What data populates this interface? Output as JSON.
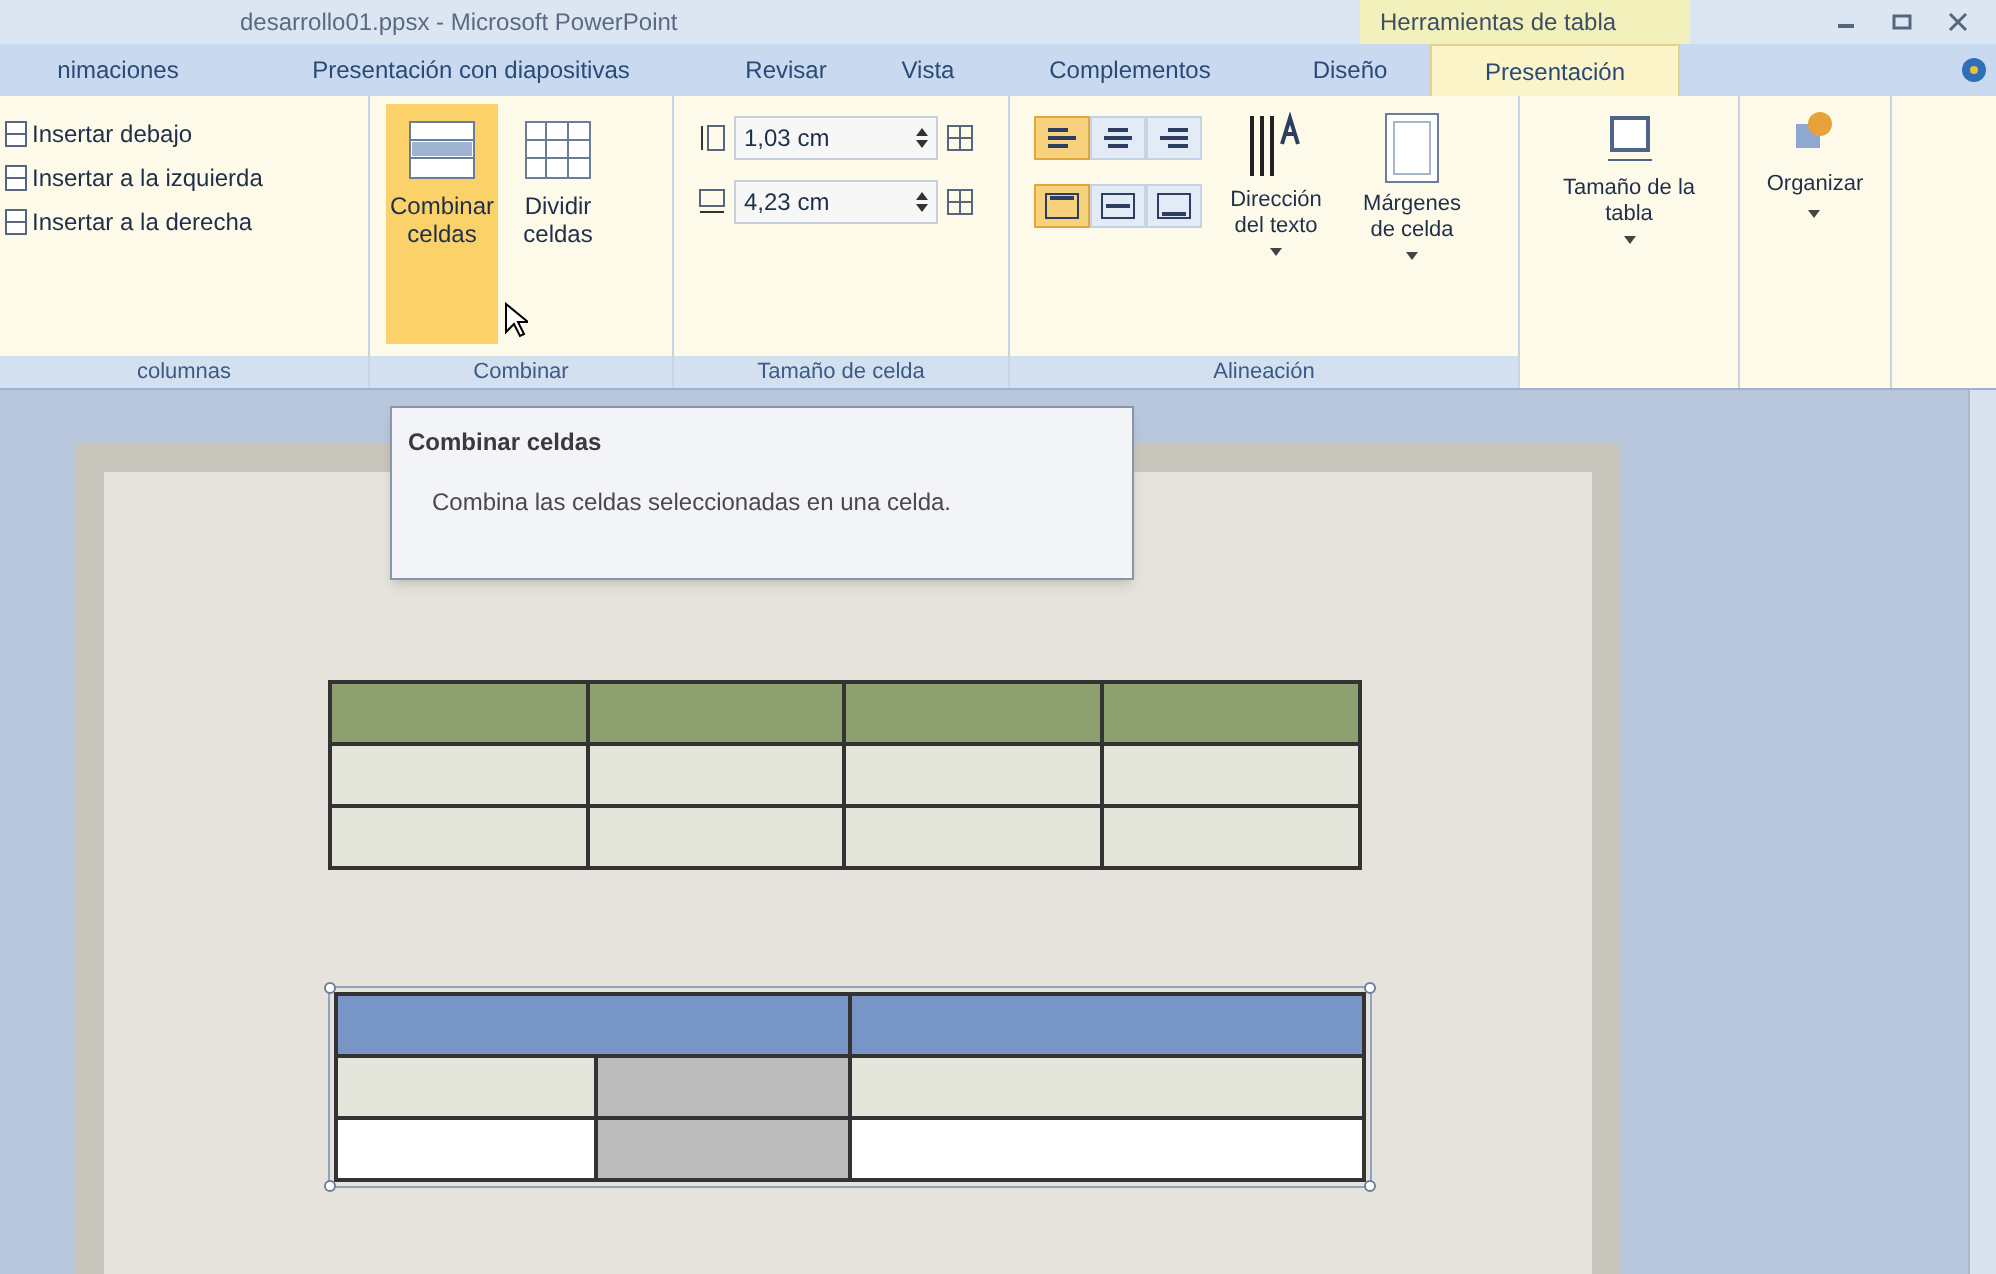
{
  "window": {
    "title": "desarrollo01.ppsx - Microsoft PowerPoint",
    "context_tab": "Herramientas de tabla"
  },
  "tabs": [
    {
      "label": "nimaciones",
      "selected": false
    },
    {
      "label": "Presentación con diapositivas",
      "selected": false
    },
    {
      "label": "Revisar",
      "selected": false
    },
    {
      "label": "Vista",
      "selected": false
    },
    {
      "label": "Complementos",
      "selected": false
    },
    {
      "label": "Diseño",
      "selected": false
    },
    {
      "label": "Presentación",
      "selected": true
    }
  ],
  "ribbon": {
    "columns_group": {
      "label": "columnas",
      "items": [
        "Insertar debajo",
        "Insertar a la izquierda",
        "Insertar a la derecha"
      ]
    },
    "merge_group": {
      "label": "Combinar",
      "buttons": [
        {
          "label": "Combinar celdas",
          "selected": true
        },
        {
          "label": "Dividir celdas",
          "selected": false
        }
      ]
    },
    "cell_size_group": {
      "label": "Tamaño de celda",
      "fields": [
        {
          "kind": "height",
          "value": "1,03 cm"
        },
        {
          "kind": "width",
          "value": "4,23 cm"
        }
      ]
    },
    "alignment_group": {
      "label": "Alineación",
      "horizontal": [
        {
          "kind": "left",
          "selected": true
        },
        {
          "kind": "center",
          "selected": false
        },
        {
          "kind": "right",
          "selected": false
        }
      ],
      "vertical": [
        {
          "kind": "top",
          "selected": true
        },
        {
          "kind": "middle",
          "selected": false
        },
        {
          "kind": "bottom",
          "selected": false
        }
      ],
      "buttons": [
        {
          "kind": "direction",
          "label": "Dirección del texto"
        },
        {
          "kind": "margins",
          "label": "Márgenes de celda"
        }
      ]
    },
    "table_size_group": {
      "label": "Tamaño de la tabla"
    },
    "arrange_group": {
      "label": "Organizar"
    }
  },
  "tooltip": {
    "title": "Combinar celdas",
    "text": "Combina las celdas seleccionadas en una celda."
  },
  "slide": {
    "tables": [
      {
        "color": "#8da06f",
        "selected": false,
        "rows": [
          {
            "kind": "header",
            "cells": [
              {
                "kind": "single",
                "selected": false
              },
              {
                "kind": "single",
                "selected": false
              },
              {
                "kind": "single",
                "selected": false
              },
              {
                "kind": "single",
                "selected": false
              }
            ]
          },
          {
            "kind": "banded",
            "cells": [
              {
                "kind": "single",
                "selected": false
              },
              {
                "kind": "single",
                "selected": false
              },
              {
                "kind": "single",
                "selected": false
              },
              {
                "kind": "single",
                "selected": false
              }
            ]
          },
          {
            "kind": "banded",
            "cells": [
              {
                "kind": "single",
                "selected": false
              },
              {
                "kind": "single",
                "selected": false
              },
              {
                "kind": "single",
                "selected": false
              },
              {
                "kind": "single",
                "selected": false
              }
            ]
          }
        ]
      },
      {
        "color": "#7895c7",
        "selected": true,
        "rows": [
          {
            "kind": "header",
            "cells": [
              {
                "kind": "merged",
                "selected": false
              },
              {
                "kind": "single",
                "selected": false
              }
            ]
          },
          {
            "kind": "banded",
            "cells": [
              {
                "kind": "single",
                "selected": false
              },
              {
                "kind": "single",
                "selected": true
              },
              {
                "kind": "single",
                "selected": false
              }
            ]
          },
          {
            "kind": "plain",
            "cells": [
              {
                "kind": "single",
                "selected": false
              },
              {
                "kind": "single",
                "selected": true
              },
              {
                "kind": "single",
                "selected": false
              }
            ]
          }
        ]
      }
    ]
  }
}
